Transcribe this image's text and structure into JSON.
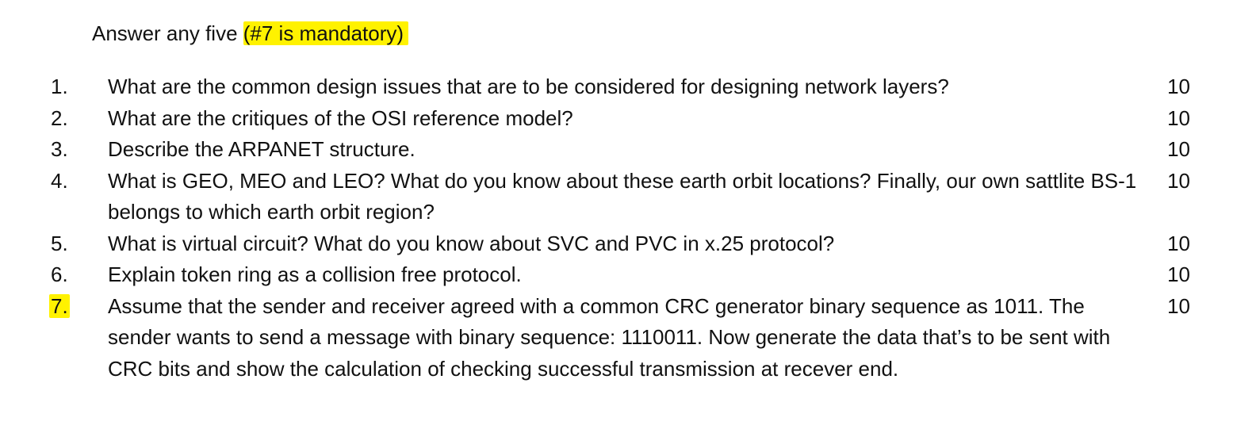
{
  "instruction": {
    "prefix": "Answer any five ",
    "highlighted": "(#7 is mandatory)"
  },
  "questions": [
    {
      "number": "1.",
      "text": "What are the common design issues that are to be considered for designing network layers?",
      "marks": "10"
    },
    {
      "number": "2.",
      "text": "What are the critiques of the OSI reference model?",
      "marks": "10"
    },
    {
      "number": "3.",
      "text": "Describe the ARPANET structure.",
      "marks": "10"
    },
    {
      "number": "4.",
      "text": "What is GEO, MEO and LEO? What do you know about these earth orbit locations? Finally, our own sattlite BS-1 belongs to which earth orbit region?",
      "marks": "10"
    },
    {
      "number": "5.",
      "text": "What is virtual circuit? What do you know about SVC and PVC in x.25 protocol?",
      "marks": "10"
    },
    {
      "number": "6.",
      "text": "Explain token ring as a collision free protocol.",
      "marks": "10"
    },
    {
      "number": "7.",
      "text": "Assume that the sender and receiver agreed with a common CRC generator binary sequence as 1011. The sender wants to send a message with binary sequence: 1110011. Now generate the data that’s to be sent with CRC bits and show the calculation of checking successful transmission at recever end.",
      "marks": "10"
    }
  ],
  "colors": {
    "highlight": "#fff200",
    "text": "#111111"
  }
}
